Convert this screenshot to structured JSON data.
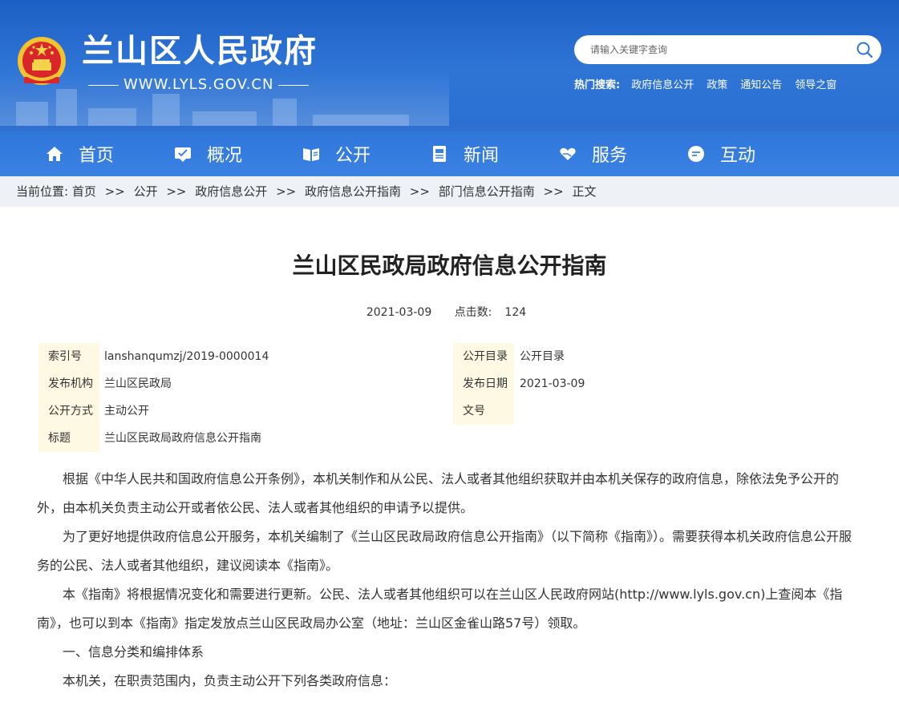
{
  "header": {
    "site_title": "兰山区人民政府",
    "site_url": "WWW.LYLS.GOV.CN",
    "search_placeholder": "请输入关键字查询",
    "hot_label": "热门搜索:",
    "hot_links": [
      "政府信息公开",
      "政策",
      "通知公告",
      "领导之窗"
    ]
  },
  "nav": {
    "items": [
      {
        "label": "首页",
        "icon": "home-icon"
      },
      {
        "label": "概况",
        "icon": "profile-icon"
      },
      {
        "label": "公开",
        "icon": "book-icon"
      },
      {
        "label": "新闻",
        "icon": "news-icon"
      },
      {
        "label": "服务",
        "icon": "heart-hand-icon"
      },
      {
        "label": "互动",
        "icon": "chat-icon"
      }
    ]
  },
  "breadcrumb": {
    "prefix": "当前位置:",
    "items": [
      "首页",
      "公开",
      "政府信息公开",
      "政府信息公开指南",
      "部门信息公开指南",
      "正文"
    ],
    "separator": ">>"
  },
  "article": {
    "title": "兰山区民政局政府信息公开指南",
    "date": "2021-03-09",
    "hits_label": "点击数:",
    "hits": "124",
    "info": {
      "index_label": "索引号",
      "index_value": "lanshanqumzj/2019-0000014",
      "catalog_label": "公开目录",
      "catalog_value": "公开目录",
      "org_label": "发布机构",
      "org_value": "兰山区民政局",
      "pubdate_label": "发布日期",
      "pubdate_value": "2021-03-09",
      "method_label": "公开方式",
      "method_value": "主动公开",
      "docno_label": "文号",
      "docno_value": "",
      "subject_label": "标题",
      "subject_value": "兰山区民政局政府信息公开指南"
    },
    "paragraphs": [
      "根据《中华人民共和国政府信息公开条例》，本机关制作和从公民、法人或者其他组织获取并由本机关保存的政府信息，除依法免予公开的外，由本机关负责主动公开或者依公民、法人或者其他组织的申请予以提供。",
      "为了更好地提供政府信息公开服务，本机关编制了《兰山区民政局政府信息公开指南》（以下简称《指南》）。需要获得本机关政府信息公开服务的公民、法人或者其他组织，建议阅读本《指南》。",
      "本《指南》将根据情况变化和需要进行更新。公民、法人或者其他组织可以在兰山区人民政府网站(http://www.lyls.gov.cn)上查阅本《指南》，也可以到本《指南》指定发放点兰山区民政局办公室（地址：兰山区金雀山路57号）领取。",
      "一、信息分类和编排体系",
      "本机关，在职责范围内，负责主动公开下列各类政府信息："
    ]
  },
  "colors": {
    "header_blue": "#2f75d6",
    "nav_blue": "#3a82e2",
    "breadcrumb_bg": "#eef1f5",
    "label_bg": "#fdf9e3"
  }
}
